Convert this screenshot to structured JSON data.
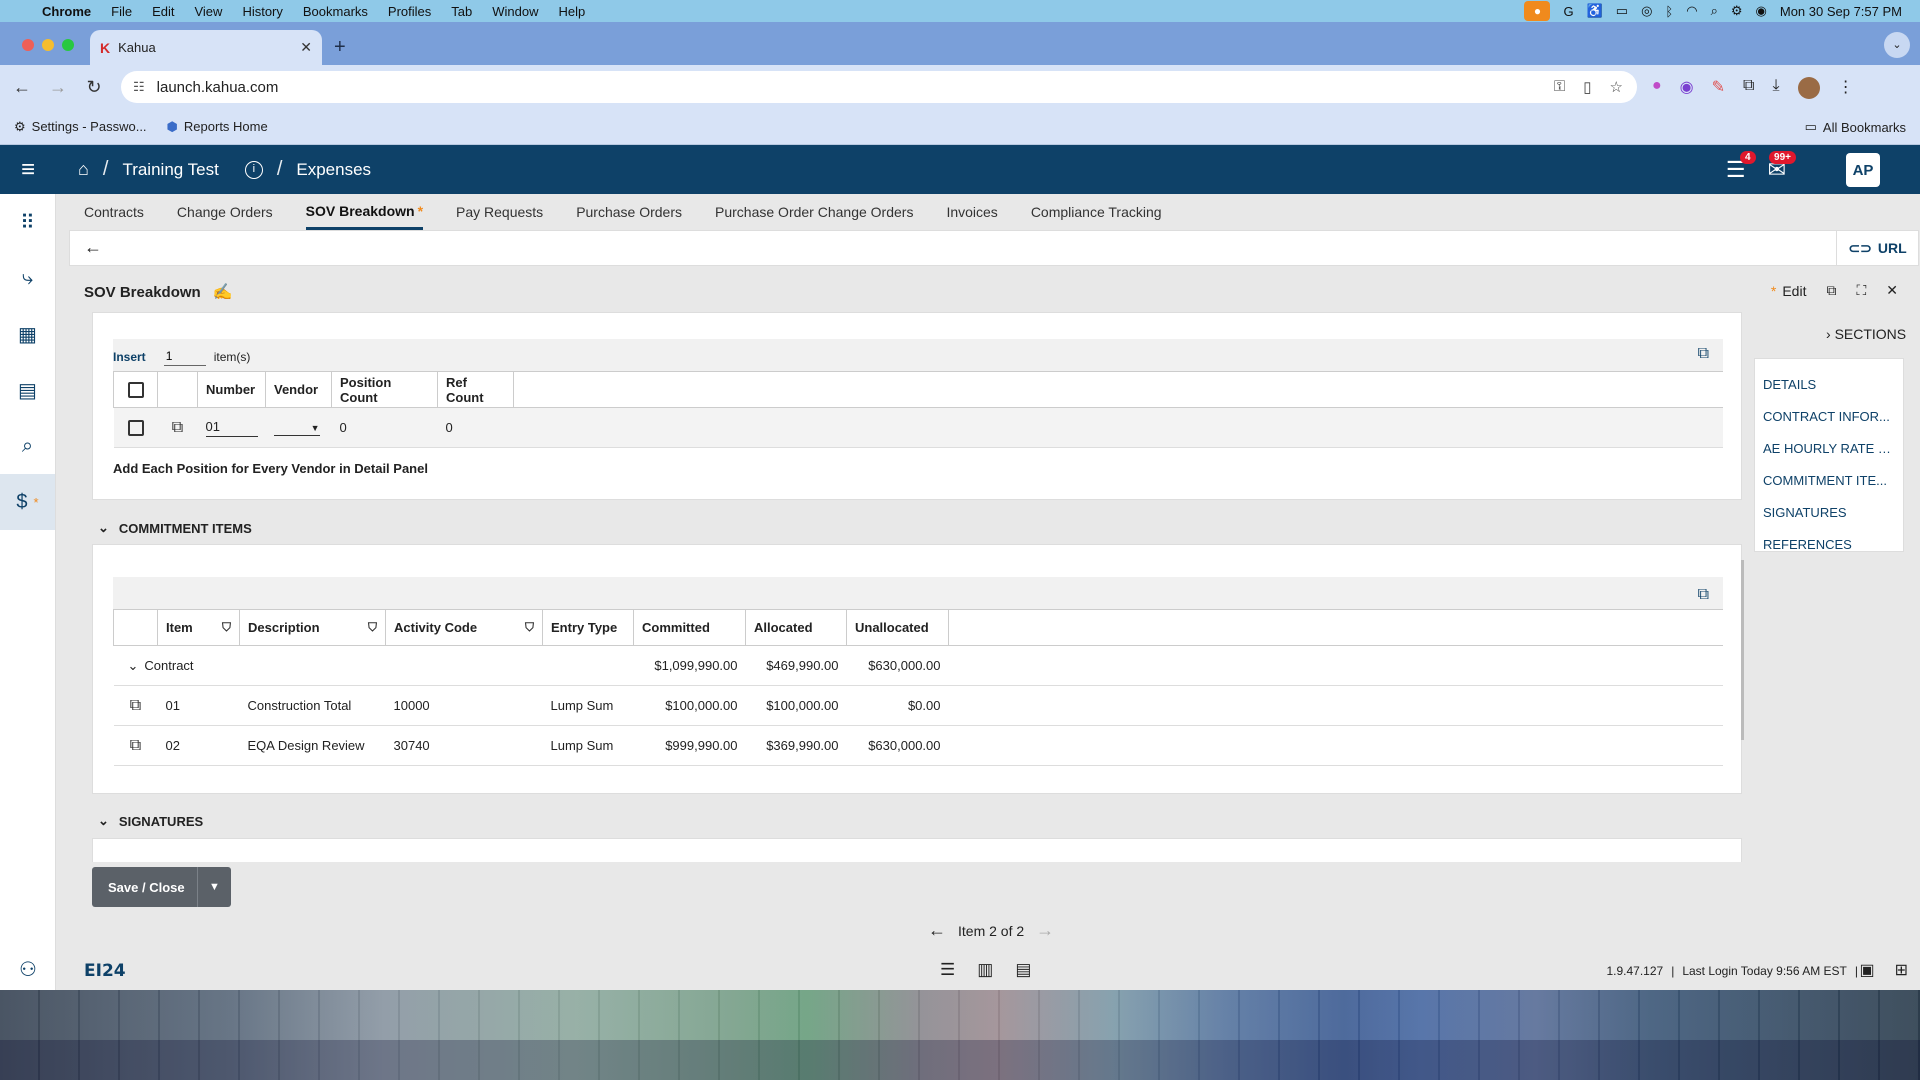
{
  "mac_menubar": {
    "app": "Chrome",
    "items": [
      "File",
      "Edit",
      "View",
      "History",
      "Bookmarks",
      "Profiles",
      "Tab",
      "Window",
      "Help"
    ],
    "datetime": "Mon 30 Sep  7:57 PM"
  },
  "browser": {
    "tab_title": "Kahua",
    "tab_favicon": "K",
    "url": "launch.kahua.com",
    "bookmarks": [
      "Settings - Passwo...",
      "Reports Home"
    ],
    "all_bookmarks": "All Bookmarks"
  },
  "app_header": {
    "breadcrumb_project": "Training Test",
    "breadcrumb_module": "Expenses",
    "tasks_badge": "4",
    "messages_badge": "99+",
    "avatar_initials": "AP"
  },
  "module_tabs": [
    {
      "label": "Contracts"
    },
    {
      "label": "Change Orders"
    },
    {
      "label": "SOV Breakdown",
      "active": true,
      "marker": "*"
    },
    {
      "label": "Pay Requests"
    },
    {
      "label": "Purchase Orders"
    },
    {
      "label": "Purchase Order Change Orders"
    },
    {
      "label": "Invoices"
    },
    {
      "label": "Compliance Tracking"
    }
  ],
  "backbar": {
    "url_button": "URL"
  },
  "page": {
    "title": "SOV Breakdown",
    "edit_label": "Edit",
    "edit_marker": "*"
  },
  "sections": {
    "header": "SECTIONS",
    "links": [
      "DETAILS",
      "CONTRACT INFOR...",
      "AE HOURLY RATE S...",
      "COMMITMENT ITE...",
      "SIGNATURES",
      "REFERENCES"
    ]
  },
  "positions_grid": {
    "insert_label": "Insert",
    "insert_value": "1",
    "insert_unit": "item(s)",
    "columns": [
      "Number",
      "Vendor",
      "Position Count",
      "Ref Count"
    ],
    "rows": [
      {
        "number": "01",
        "vendor": "",
        "position_count": "0",
        "ref_count": "0"
      }
    ],
    "hint": "Add Each Position for Every Vendor in Detail Panel"
  },
  "commitment_items": {
    "section_title": "COMMITMENT ITEMS",
    "columns": [
      "Item",
      "Description",
      "Activity Code",
      "Entry Type",
      "Committed",
      "Allocated",
      "Unallocated"
    ],
    "group": {
      "label": "Contract",
      "committed": "$1,099,990.00",
      "allocated": "$469,990.00",
      "unallocated": "$630,000.00"
    },
    "rows": [
      {
        "item": "01",
        "description": "Construction Total",
        "activity_code": "10000",
        "entry_type": "Lump Sum",
        "committed": "$100,000.00",
        "allocated": "$100,000.00",
        "unallocated": "$0.00"
      },
      {
        "item": "02",
        "description": "EQA Design Review",
        "activity_code": "30740",
        "entry_type": "Lump Sum",
        "committed": "$999,990.00",
        "allocated": "$369,990.00",
        "unallocated": "$630,000.00"
      }
    ]
  },
  "signatures": {
    "section_title": "SIGNATURES"
  },
  "actions": {
    "save_close": "Save / Close"
  },
  "pager": {
    "label": "Item 2 of 2"
  },
  "footer": {
    "logo": "EI24",
    "version": "1.9.47.127",
    "last_login": "Last Login Today 9:56 AM EST"
  }
}
